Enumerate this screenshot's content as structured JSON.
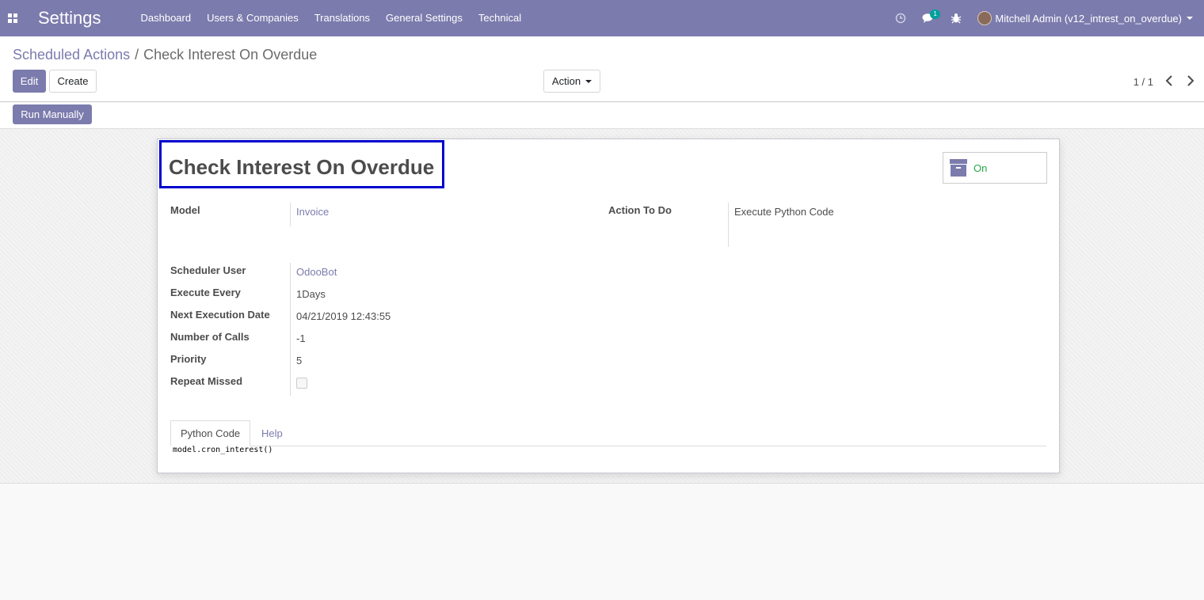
{
  "navbar": {
    "brand": "Settings",
    "menu": [
      "Dashboard",
      "Users & Companies",
      "Translations",
      "General Settings",
      "Technical"
    ],
    "icons": [
      "apps-icon",
      "clock-icon",
      "chat-icon",
      "bug-icon"
    ],
    "chat_badge": "1",
    "user": "Mitchell Admin (v12_intrest_on_overdue)",
    "bg_color": "#7c7bad"
  },
  "breadcrumb": {
    "parent": "Scheduled Actions",
    "separator": "/",
    "current": "Check Interest On Overdue"
  },
  "buttons": {
    "edit": "Edit",
    "create": "Create",
    "action": "Action",
    "run_manually": "Run Manually"
  },
  "pager": {
    "value": "1 / 1"
  },
  "record": {
    "title": "Check Interest On Overdue",
    "active_toggle": "On",
    "fields": {
      "model_label": "Model",
      "model_value": "Invoice",
      "action_to_do_label": "Action To Do",
      "action_to_do_value": "Execute Python Code",
      "scheduler_user_label": "Scheduler User",
      "scheduler_user_value": "OdooBot",
      "execute_every_label": "Execute Every",
      "execute_every_value": "1Days",
      "next_execution_label": "Next Execution Date",
      "next_execution_value": "04/21/2019 12:43:55",
      "number_of_calls_label": "Number of Calls",
      "number_of_calls_value": "-1",
      "priority_label": "Priority",
      "priority_value": "5",
      "repeat_missed_label": "Repeat Missed",
      "repeat_missed_value": false
    },
    "tabs": [
      "Python Code",
      "Help"
    ],
    "python_code": "model.cron_interest()"
  },
  "colors": {
    "accent": "#7c7bad",
    "active": "#28a745",
    "highlight_border": "#0000cc"
  }
}
